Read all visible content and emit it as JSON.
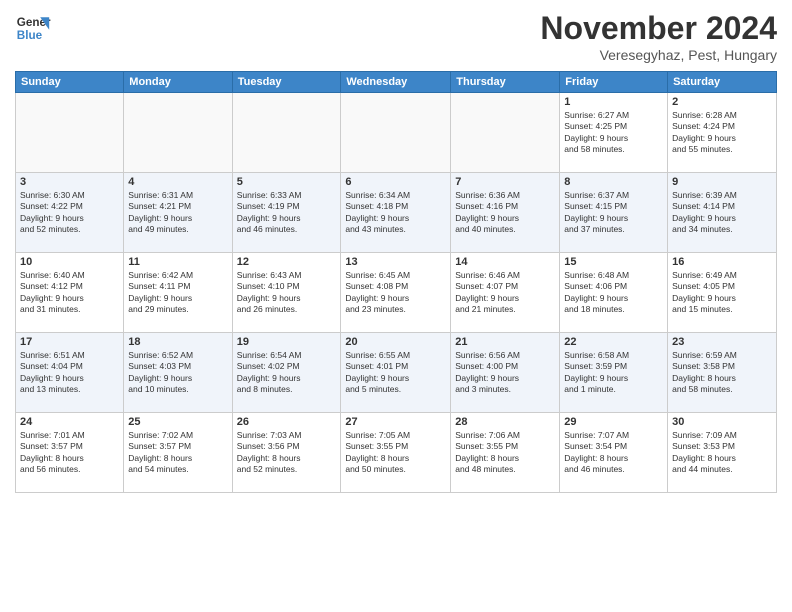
{
  "logo": {
    "line1": "General",
    "line2": "Blue"
  },
  "title": "November 2024",
  "location": "Veresegyhaz, Pest, Hungary",
  "days_of_week": [
    "Sunday",
    "Monday",
    "Tuesday",
    "Wednesday",
    "Thursday",
    "Friday",
    "Saturday"
  ],
  "weeks": [
    [
      {
        "day": "",
        "info": ""
      },
      {
        "day": "",
        "info": ""
      },
      {
        "day": "",
        "info": ""
      },
      {
        "day": "",
        "info": ""
      },
      {
        "day": "",
        "info": ""
      },
      {
        "day": "1",
        "info": "Sunrise: 6:27 AM\nSunset: 4:25 PM\nDaylight: 9 hours\nand 58 minutes."
      },
      {
        "day": "2",
        "info": "Sunrise: 6:28 AM\nSunset: 4:24 PM\nDaylight: 9 hours\nand 55 minutes."
      }
    ],
    [
      {
        "day": "3",
        "info": "Sunrise: 6:30 AM\nSunset: 4:22 PM\nDaylight: 9 hours\nand 52 minutes."
      },
      {
        "day": "4",
        "info": "Sunrise: 6:31 AM\nSunset: 4:21 PM\nDaylight: 9 hours\nand 49 minutes."
      },
      {
        "day": "5",
        "info": "Sunrise: 6:33 AM\nSunset: 4:19 PM\nDaylight: 9 hours\nand 46 minutes."
      },
      {
        "day": "6",
        "info": "Sunrise: 6:34 AM\nSunset: 4:18 PM\nDaylight: 9 hours\nand 43 minutes."
      },
      {
        "day": "7",
        "info": "Sunrise: 6:36 AM\nSunset: 4:16 PM\nDaylight: 9 hours\nand 40 minutes."
      },
      {
        "day": "8",
        "info": "Sunrise: 6:37 AM\nSunset: 4:15 PM\nDaylight: 9 hours\nand 37 minutes."
      },
      {
        "day": "9",
        "info": "Sunrise: 6:39 AM\nSunset: 4:14 PM\nDaylight: 9 hours\nand 34 minutes."
      }
    ],
    [
      {
        "day": "10",
        "info": "Sunrise: 6:40 AM\nSunset: 4:12 PM\nDaylight: 9 hours\nand 31 minutes."
      },
      {
        "day": "11",
        "info": "Sunrise: 6:42 AM\nSunset: 4:11 PM\nDaylight: 9 hours\nand 29 minutes."
      },
      {
        "day": "12",
        "info": "Sunrise: 6:43 AM\nSunset: 4:10 PM\nDaylight: 9 hours\nand 26 minutes."
      },
      {
        "day": "13",
        "info": "Sunrise: 6:45 AM\nSunset: 4:08 PM\nDaylight: 9 hours\nand 23 minutes."
      },
      {
        "day": "14",
        "info": "Sunrise: 6:46 AM\nSunset: 4:07 PM\nDaylight: 9 hours\nand 21 minutes."
      },
      {
        "day": "15",
        "info": "Sunrise: 6:48 AM\nSunset: 4:06 PM\nDaylight: 9 hours\nand 18 minutes."
      },
      {
        "day": "16",
        "info": "Sunrise: 6:49 AM\nSunset: 4:05 PM\nDaylight: 9 hours\nand 15 minutes."
      }
    ],
    [
      {
        "day": "17",
        "info": "Sunrise: 6:51 AM\nSunset: 4:04 PM\nDaylight: 9 hours\nand 13 minutes."
      },
      {
        "day": "18",
        "info": "Sunrise: 6:52 AM\nSunset: 4:03 PM\nDaylight: 9 hours\nand 10 minutes."
      },
      {
        "day": "19",
        "info": "Sunrise: 6:54 AM\nSunset: 4:02 PM\nDaylight: 9 hours\nand 8 minutes."
      },
      {
        "day": "20",
        "info": "Sunrise: 6:55 AM\nSunset: 4:01 PM\nDaylight: 9 hours\nand 5 minutes."
      },
      {
        "day": "21",
        "info": "Sunrise: 6:56 AM\nSunset: 4:00 PM\nDaylight: 9 hours\nand 3 minutes."
      },
      {
        "day": "22",
        "info": "Sunrise: 6:58 AM\nSunset: 3:59 PM\nDaylight: 9 hours\nand 1 minute."
      },
      {
        "day": "23",
        "info": "Sunrise: 6:59 AM\nSunset: 3:58 PM\nDaylight: 8 hours\nand 58 minutes."
      }
    ],
    [
      {
        "day": "24",
        "info": "Sunrise: 7:01 AM\nSunset: 3:57 PM\nDaylight: 8 hours\nand 56 minutes."
      },
      {
        "day": "25",
        "info": "Sunrise: 7:02 AM\nSunset: 3:57 PM\nDaylight: 8 hours\nand 54 minutes."
      },
      {
        "day": "26",
        "info": "Sunrise: 7:03 AM\nSunset: 3:56 PM\nDaylight: 8 hours\nand 52 minutes."
      },
      {
        "day": "27",
        "info": "Sunrise: 7:05 AM\nSunset: 3:55 PM\nDaylight: 8 hours\nand 50 minutes."
      },
      {
        "day": "28",
        "info": "Sunrise: 7:06 AM\nSunset: 3:55 PM\nDaylight: 8 hours\nand 48 minutes."
      },
      {
        "day": "29",
        "info": "Sunrise: 7:07 AM\nSunset: 3:54 PM\nDaylight: 8 hours\nand 46 minutes."
      },
      {
        "day": "30",
        "info": "Sunrise: 7:09 AM\nSunset: 3:53 PM\nDaylight: 8 hours\nand 44 minutes."
      }
    ]
  ]
}
